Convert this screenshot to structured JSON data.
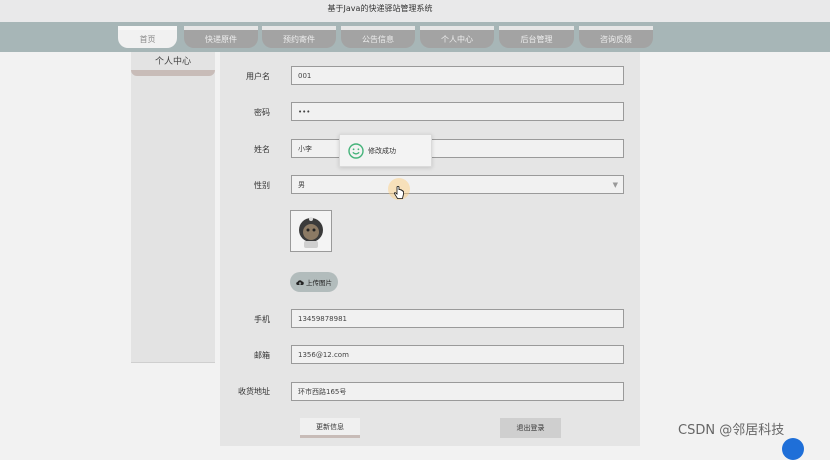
{
  "header": {
    "site_title": "基于Java的快递驿站管理系统"
  },
  "nav": {
    "items": [
      {
        "label": "首页",
        "active": true
      },
      {
        "label": "快递原件",
        "active": false
      },
      {
        "label": "预约寄件",
        "active": false
      },
      {
        "label": "公告信息",
        "active": false
      },
      {
        "label": "个人中心",
        "active": false
      },
      {
        "label": "后台管理",
        "active": false
      },
      {
        "label": "咨询反馈",
        "active": false
      }
    ]
  },
  "sidebar": {
    "title": "个人中心"
  },
  "form": {
    "username": {
      "label": "用户名",
      "value": "001"
    },
    "password": {
      "label": "密码",
      "value": "•••"
    },
    "name": {
      "label": "姓名",
      "value": "小李"
    },
    "gender": {
      "label": "性别",
      "value": "男"
    },
    "upload_label": "上传图片",
    "phone": {
      "label": "手机",
      "value": "13459878981"
    },
    "email": {
      "label": "邮箱",
      "value": "1356@12.com"
    },
    "address": {
      "label": "收货地址",
      "value": "环市西路165号"
    },
    "update_button": "更新信息",
    "logout_button": "退出登录"
  },
  "toast": {
    "message": "修改成功",
    "icon": "smile-icon",
    "color": "#45b37a"
  },
  "watermark": "CSDN @邻居科技",
  "colors": {
    "navbar": "#a7b6b7",
    "accent": "#c8bcb8"
  }
}
